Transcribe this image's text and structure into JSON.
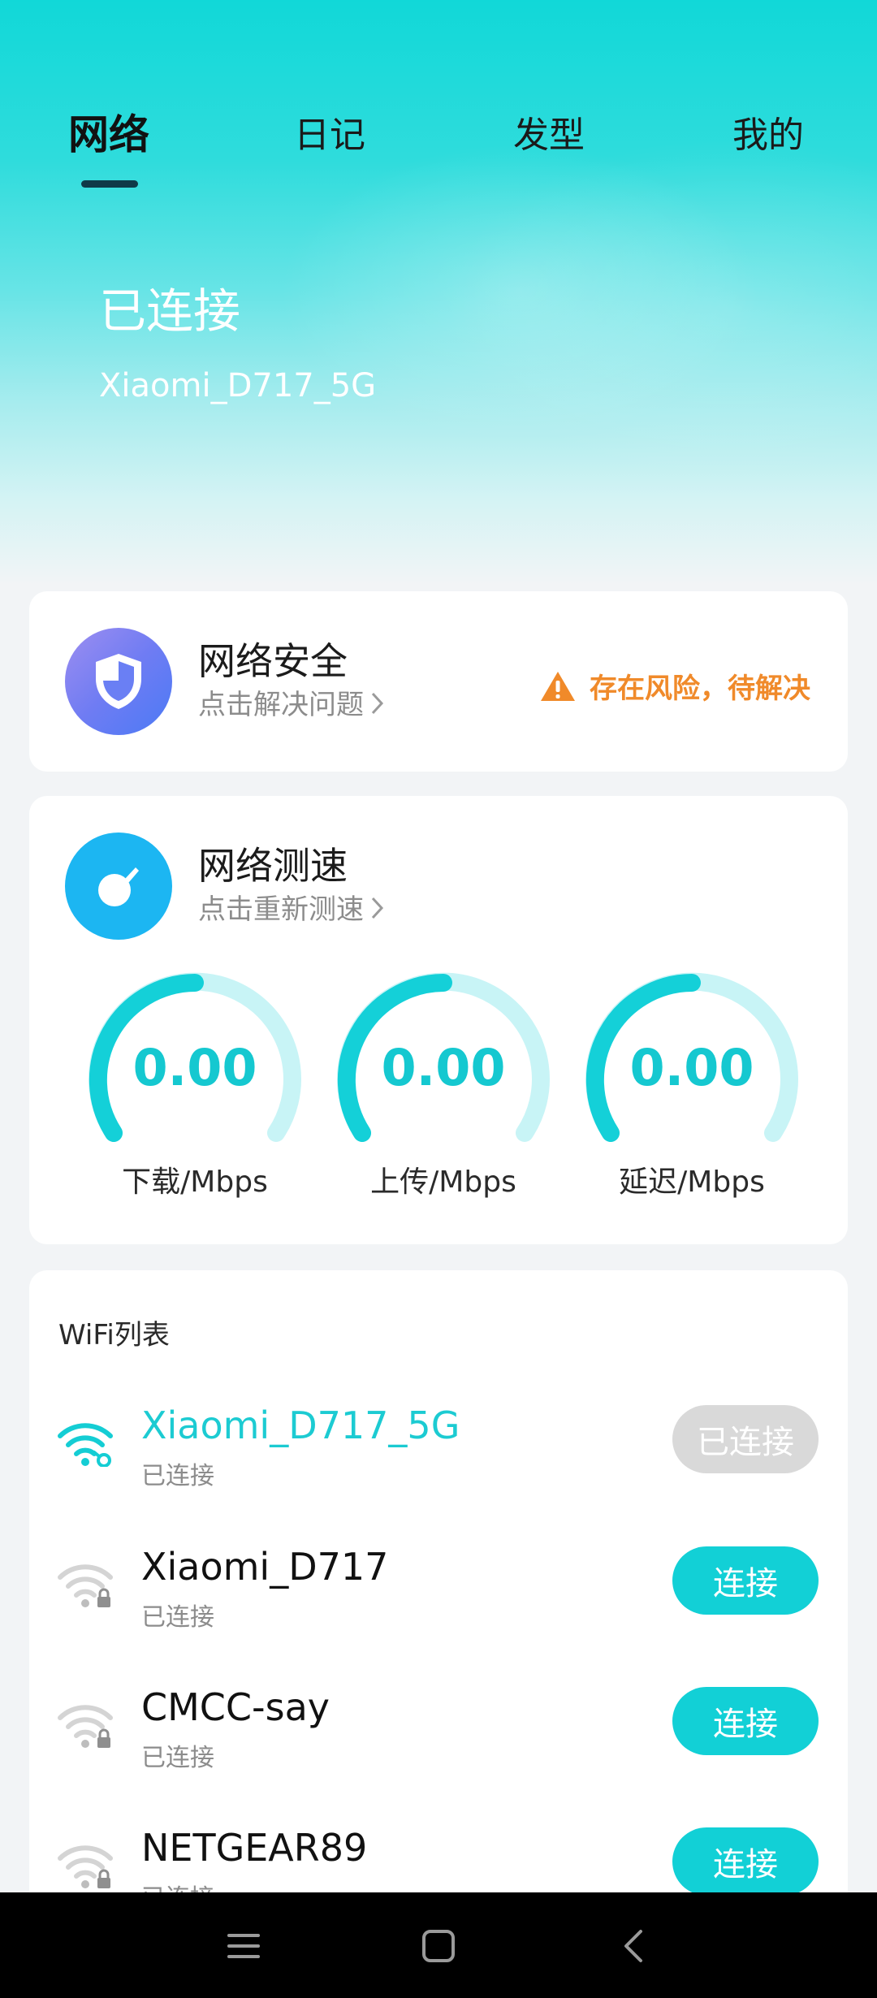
{
  "tabs": [
    {
      "label": "网络",
      "active": true
    },
    {
      "label": "日记",
      "active": false
    },
    {
      "label": "发型",
      "active": false
    },
    {
      "label": "我的",
      "active": false
    }
  ],
  "hero": {
    "status": "已连接",
    "ssid": "Xiaomi_D717_5G"
  },
  "security": {
    "title": "网络安全",
    "subtitle": "点击解决问题",
    "risk_text": "存在风险，待解决",
    "icon": "shield-icon",
    "risk_color": "#f08a2a"
  },
  "speed": {
    "title": "网络测速",
    "subtitle": "点击重新测速",
    "icon": "speedometer-icon",
    "gauges": [
      {
        "value": "0.00",
        "label": "下载/Mbps"
      },
      {
        "value": "0.00",
        "label": "上传/Mbps"
      },
      {
        "value": "0.00",
        "label": "延迟/Mbps"
      }
    ]
  },
  "wifi_list": {
    "title": "WiFi列表",
    "items": [
      {
        "name": "Xiaomi_D717_5G",
        "status": "已连接",
        "button": "已连接",
        "current": true
      },
      {
        "name": "Xiaomi_D717",
        "status": "已连接",
        "button": "连接",
        "current": false
      },
      {
        "name": "CMCC-say",
        "status": "已连接",
        "button": "连接",
        "current": false
      },
      {
        "name": "NETGEAR89",
        "status": "已连接",
        "button": "连接",
        "current": false
      }
    ]
  },
  "colors": {
    "accent": "#12d0d6",
    "title_active": "#111111"
  }
}
